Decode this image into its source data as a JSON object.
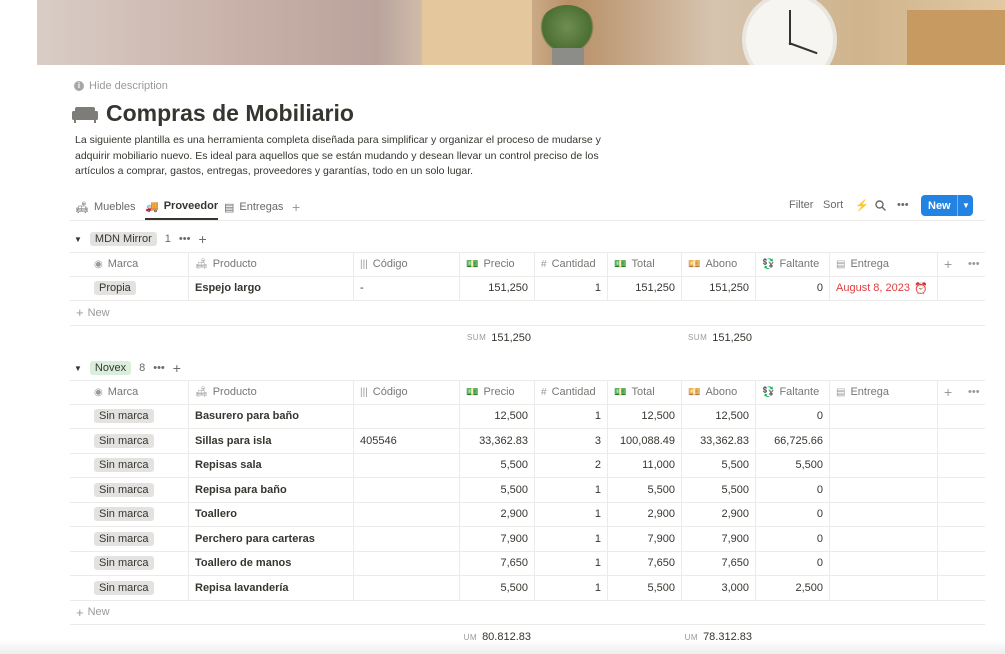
{
  "page": {
    "hide_description": "Hide description",
    "title": "Compras de Mobiliario",
    "description": "La siguiente plantilla es una herramienta completa diseñada para simplificar y organizar el proceso de mudarse y adquirir mobiliario nuevo. Es ideal para aquellos que se están mudando y desean llevar un control preciso de los artículos a comprar, gastos, entregas, proveedores y garantías, todo en un solo lugar."
  },
  "tabs": [
    {
      "label": "Muebles",
      "icon": "sofa-icon"
    },
    {
      "label": "Proveedor",
      "icon": "truck-icon",
      "active": true
    },
    {
      "label": "Entregas",
      "icon": "calendar-icon"
    }
  ],
  "toolbar": {
    "filter": "Filter",
    "sort": "Sort",
    "new": "New"
  },
  "columns": [
    "Marca",
    "Producto",
    "Código",
    "Precio",
    "Cantidad",
    "Total",
    "Abono",
    "Faltante",
    "Entrega"
  ],
  "new_row_label": "New",
  "groups": [
    {
      "name": "MDN Mirror",
      "count": "1",
      "rows": [
        {
          "marca": "Propia",
          "producto": "Espejo largo",
          "codigo": "-",
          "precio": "151,250",
          "cantidad": "1",
          "total": "151,250",
          "abono": "151,250",
          "faltante": "0",
          "entrega": "August 8, 2023"
        }
      ],
      "sum_precio_label": "SUM",
      "sum_precio": "151,250",
      "sum_abono_label": "SUM",
      "sum_abono": "151,250"
    },
    {
      "name": "Novex",
      "count": "8",
      "rows": [
        {
          "marca": "Sin marca",
          "producto": "Basurero para baño",
          "codigo": "",
          "precio": "12,500",
          "cantidad": "1",
          "total": "12,500",
          "abono": "12,500",
          "faltante": "0",
          "entrega": ""
        },
        {
          "marca": "Sin marca",
          "producto": "Sillas para isla",
          "codigo": "405546",
          "precio": "33,362.83",
          "cantidad": "3",
          "total": "100,088.49",
          "abono": "33,362.83",
          "faltante": "66,725.66",
          "entrega": ""
        },
        {
          "marca": "Sin marca",
          "producto": "Repisas sala",
          "codigo": "",
          "precio": "5,500",
          "cantidad": "2",
          "total": "11,000",
          "abono": "5,500",
          "faltante": "5,500",
          "entrega": ""
        },
        {
          "marca": "Sin marca",
          "producto": "Repisa para baño",
          "codigo": "",
          "precio": "5,500",
          "cantidad": "1",
          "total": "5,500",
          "abono": "5,500",
          "faltante": "0",
          "entrega": ""
        },
        {
          "marca": "Sin marca",
          "producto": "Toallero",
          "codigo": "",
          "precio": "2,900",
          "cantidad": "1",
          "total": "2,900",
          "abono": "2,900",
          "faltante": "0",
          "entrega": ""
        },
        {
          "marca": "Sin marca",
          "producto": "Perchero para carteras",
          "codigo": "",
          "precio": "7,900",
          "cantidad": "1",
          "total": "7,900",
          "abono": "7,900",
          "faltante": "0",
          "entrega": ""
        },
        {
          "marca": "Sin marca",
          "producto": "Toallero de manos",
          "codigo": "",
          "precio": "7,650",
          "cantidad": "1",
          "total": "7,650",
          "abono": "7,650",
          "faltante": "0",
          "entrega": ""
        },
        {
          "marca": "Sin marca",
          "producto": "Repisa lavandería",
          "codigo": "",
          "precio": "5,500",
          "cantidad": "1",
          "total": "5,500",
          "abono": "3,000",
          "faltante": "2,500",
          "entrega": ""
        }
      ],
      "sum_precio_label": "UM",
      "sum_precio": "80,812.83",
      "sum_abono_label": "UM",
      "sum_abono": "78,312.83"
    }
  ]
}
